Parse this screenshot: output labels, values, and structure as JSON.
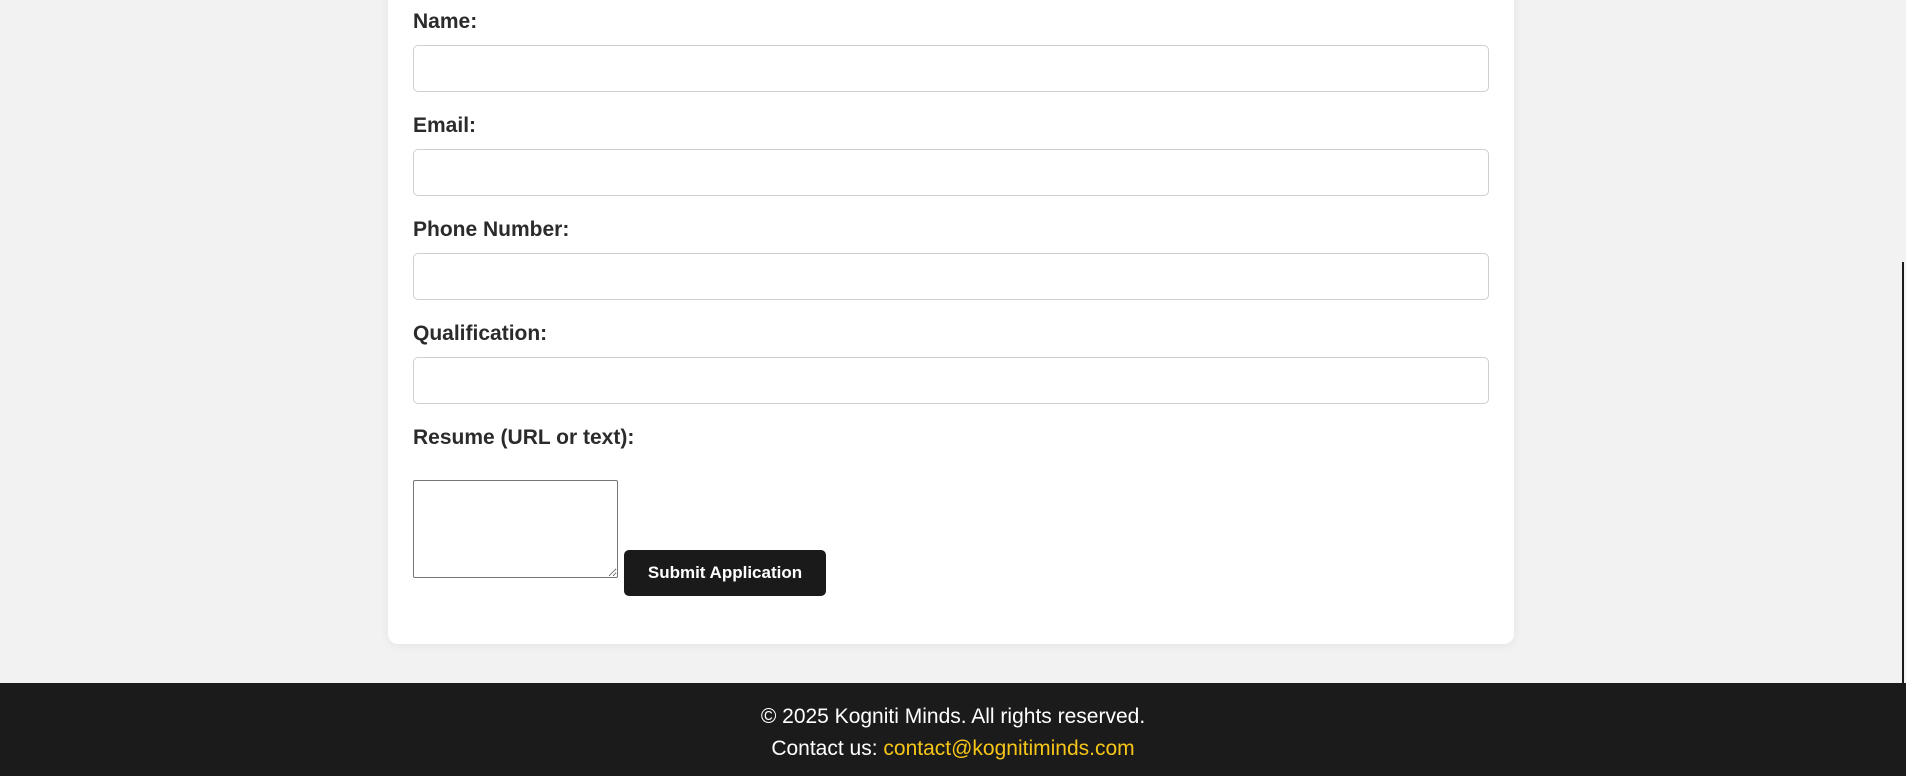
{
  "form": {
    "name_label": "Name:",
    "email_label": "Email:",
    "phone_label": "Phone Number:",
    "qualification_label": "Qualification:",
    "resume_label": "Resume (URL or text):",
    "submit_label": "Submit Application"
  },
  "footer": {
    "copyright": "© 2025 Kogniti Minds. All rights reserved.",
    "contact_prefix": "Contact us:",
    "contact_email": "contact@kognitiminds.com"
  },
  "colors": {
    "page_background": "#f2f2f2",
    "card_background": "#ffffff",
    "button_background": "#1a1a1a",
    "footer_background": "#1b1b1b",
    "link_accent": "#f5c518"
  }
}
